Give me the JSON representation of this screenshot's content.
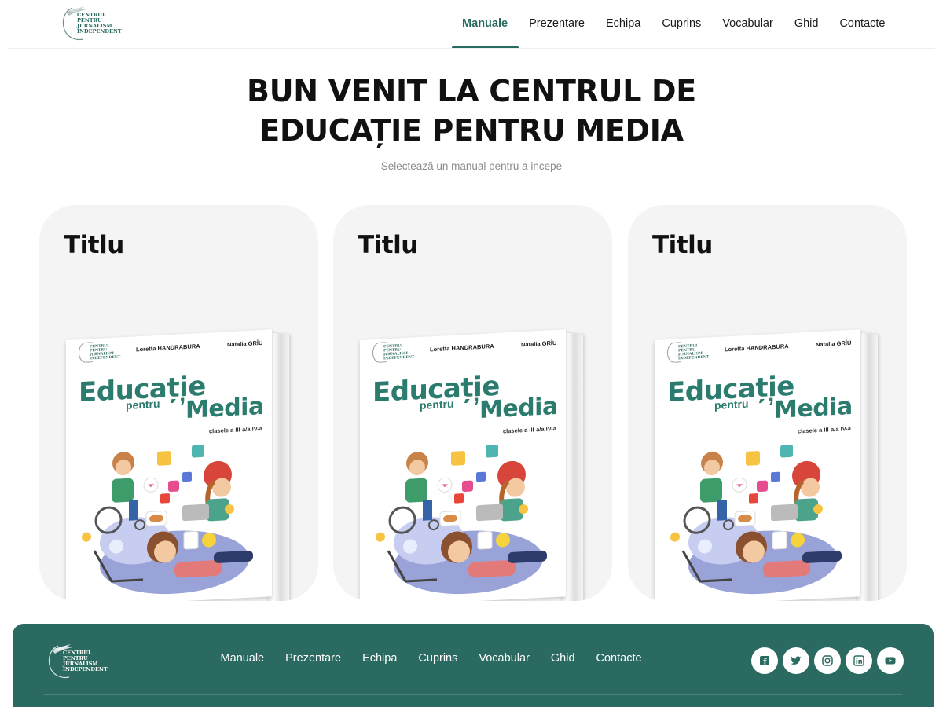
{
  "header": {
    "logo_lines": [
      "CENTRUL",
      "PENTRU",
      "JURNALISM",
      "INDEPENDENT"
    ],
    "nav": [
      {
        "label": "Manuale",
        "active": true
      },
      {
        "label": "Prezentare"
      },
      {
        "label": "Echipa"
      },
      {
        "label": "Cuprins"
      },
      {
        "label": "Vocabular"
      },
      {
        "label": "Ghid"
      },
      {
        "label": "Contacte"
      }
    ]
  },
  "hero": {
    "title_line1": "BUN VENIT LA CENTRUL DE",
    "title_line2": "EDUCAȚIE PENTRU MEDIA",
    "subtitle": "Selectează un manual pentru a incepe"
  },
  "cards": [
    {
      "title": "Titlu",
      "book": {
        "logo_lines": [
          "CENTRUL",
          "PENTRU",
          "JURNALISM",
          "INDEPENDENT"
        ],
        "author1": "Loretta HANDRABURA",
        "author2": "Natalia GRÎU",
        "word1": "Educație",
        "word2": "pentru",
        "word3": "Media",
        "grades": "clasele a III-a/a IV-a"
      }
    },
    {
      "title": "Titlu",
      "book": {
        "logo_lines": [
          "CENTRUL",
          "PENTRU",
          "JURNALISM",
          "INDEPENDENT"
        ],
        "author1": "Loretta HANDRABURA",
        "author2": "Natalia GRÎU",
        "word1": "Educație",
        "word2": "pentru",
        "word3": "Media",
        "grades": "clasele a III-a/a IV-a"
      }
    },
    {
      "title": "Titlu",
      "book": {
        "logo_lines": [
          "CENTRUL",
          "PENTRU",
          "JURNALISM",
          "INDEPENDENT"
        ],
        "author1": "Loretta HANDRABURA",
        "author2": "Natalia GRÎU",
        "word1": "Educație",
        "word2": "pentru",
        "word3": "Media",
        "grades": "clasele a III-a/a IV-a"
      }
    }
  ],
  "footer": {
    "logo_lines": [
      "CENTRUL",
      "PENTRU",
      "JURNALISM",
      "INDEPENDENT"
    ],
    "nav": [
      "Manuale",
      "Prezentare",
      "Echipa",
      "Cuprins",
      "Vocabular",
      "Ghid",
      "Contacte"
    ],
    "socials": [
      "facebook-icon",
      "twitter-icon",
      "instagram-icon",
      "linkedin-icon",
      "youtube-icon"
    ]
  },
  "colors": {
    "brand_green": "#2b6a60",
    "cover_green": "#2b7c6e",
    "card_bg": "#f4f4f4"
  }
}
